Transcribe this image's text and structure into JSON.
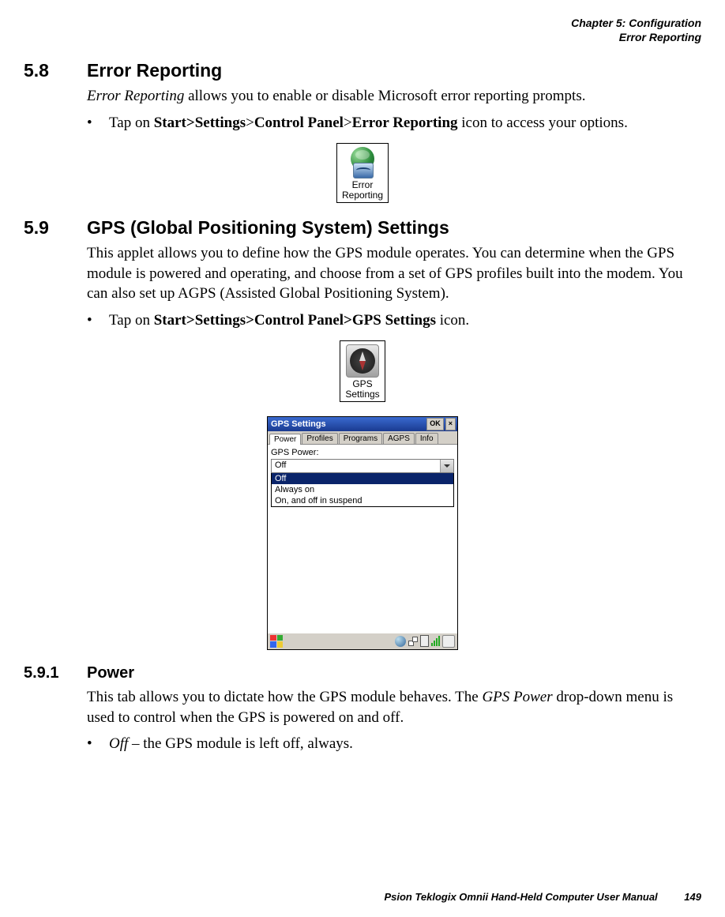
{
  "header": {
    "chapter": "Chapter 5: Configuration",
    "section": "Error Reporting"
  },
  "s58": {
    "num": "5.8",
    "title": "Error Reporting",
    "intro_em": "Error Reporting",
    "intro_rest": " allows you to enable or disable Microsoft error reporting prompts.",
    "bullet_pre": "Tap on ",
    "bullet_b1": "Start>Settings",
    "bullet_gt1": ">",
    "bullet_b2": "Control Panel",
    "bullet_gt2": ">",
    "bullet_b3": "Error Reporting",
    "bullet_post": " icon to access your options.",
    "icon_label_1": "Error",
    "icon_label_2": "Reporting"
  },
  "s59": {
    "num": "5.9",
    "title": "GPS (Global Positioning System) Settings",
    "para": "This applet allows you to define how the GPS module operates. You can determine when the GPS module is powered and operating, and choose from a set of GPS profiles built into the modem. You can also set up AGPS (Assisted Global Positioning System).",
    "bullet_pre": "Tap on ",
    "bullet_b": "Start>Settings>Control Panel>GPS Settings",
    "bullet_post": " icon.",
    "icon_label_1": "GPS",
    "icon_label_2": "Settings"
  },
  "window": {
    "title": "GPS Settings",
    "ok": "OK",
    "close": "×",
    "tabs": [
      "Power",
      "Profiles",
      "Programs",
      "AGPS",
      "Info"
    ],
    "active_tab": "Power",
    "label": "GPS Power:",
    "combo_value": "Off",
    "options": [
      "Off",
      "Always on",
      "On, and off in suspend"
    ],
    "selected_option": "Off"
  },
  "s591": {
    "num": "5.9.1",
    "title": "Power",
    "para_pre": "This tab allows you to dictate how the GPS module behaves. The ",
    "para_em": "GPS Power",
    "para_post": " drop-down menu is used to control when the GPS is powered on and off.",
    "bullet_em": "Off",
    "bullet_rest": " – the GPS module is left off, always."
  },
  "footer": {
    "text": "Psion Teklogix Omnii Hand-Held Computer User Manual",
    "page": "149"
  }
}
